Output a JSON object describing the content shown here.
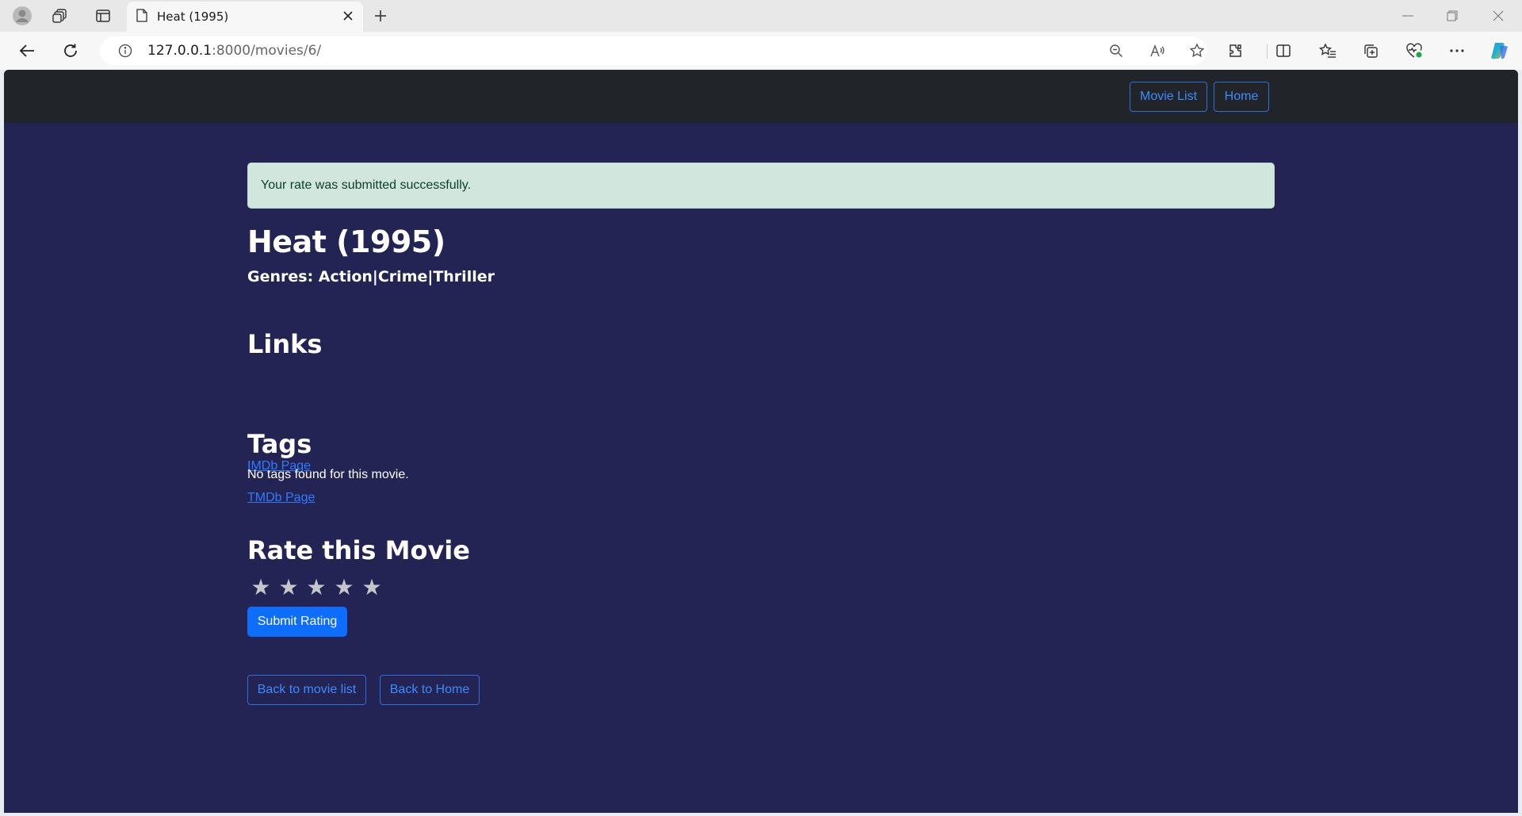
{
  "browser": {
    "tab_title": "Heat (1995)",
    "url_host": "127.0.0.1",
    "url_path": ":8000/movies/6/"
  },
  "navbar": {
    "movie_list": "Movie List",
    "home": "Home"
  },
  "alert": {
    "message": "Your rate was submitted successfully.",
    "color": "#d1e7dd"
  },
  "movie": {
    "title": "Heat (1995)",
    "genres_text": "Genres: Action|Crime|Thriller"
  },
  "links": {
    "heading": "Links",
    "imdb": "IMDb Page",
    "tmdb": "TMDb Page"
  },
  "tags": {
    "heading": "Tags",
    "empty_message": "No tags found for this movie."
  },
  "rating": {
    "heading": "Rate this Movie",
    "stars": [
      "★",
      "★",
      "★",
      "★",
      "★"
    ],
    "selected": 0,
    "submit_label": "Submit Rating"
  },
  "footer_actions": {
    "back_list": "Back to movie list",
    "back_home": "Back to Home"
  },
  "colors": {
    "page_bg": "#232454",
    "navbar_bg": "#212529",
    "primary": "#0d6efd"
  }
}
